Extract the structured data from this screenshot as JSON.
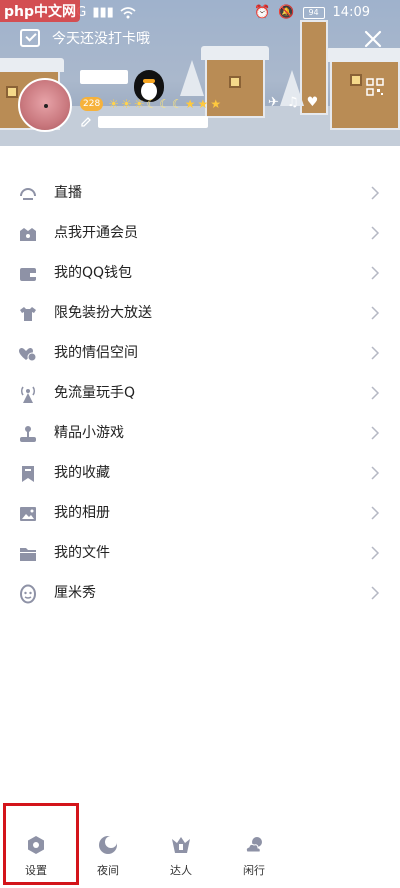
{
  "watermark": "php中文网",
  "status_bar": {
    "signal": "4G",
    "battery": "94",
    "time": "14:09"
  },
  "header": {
    "checkin_text": "今天还没打卡哦",
    "level_badge": "228",
    "icons": [
      "calendar-check-icon",
      "close-icon",
      "qr-code-icon",
      "edit-icon"
    ]
  },
  "menu": {
    "items": [
      {
        "label": "直播",
        "icon": "live-icon"
      },
      {
        "label": "点我开通会员",
        "icon": "vip-crown-icon"
      },
      {
        "label": "我的QQ钱包",
        "icon": "wallet-icon"
      },
      {
        "label": "限免装扮大放送",
        "icon": "shirt-icon"
      },
      {
        "label": "我的情侣空间",
        "icon": "hearts-icon"
      },
      {
        "label": "免流量玩手Q",
        "icon": "antenna-icon"
      },
      {
        "label": "精品小游戏",
        "icon": "joystick-icon"
      },
      {
        "label": "我的收藏",
        "icon": "bookmark-icon"
      },
      {
        "label": "我的相册",
        "icon": "photo-icon"
      },
      {
        "label": "我的文件",
        "icon": "folder-icon"
      },
      {
        "label": "厘米秀",
        "icon": "face-icon"
      }
    ]
  },
  "bottom_bar": {
    "tabs": [
      {
        "label": "设置",
        "icon": "settings-icon"
      },
      {
        "label": "夜间",
        "icon": "moon-icon"
      },
      {
        "label": "达人",
        "icon": "talent-icon"
      },
      {
        "label": "闲行",
        "icon": "weather-icon"
      }
    ]
  },
  "colors": {
    "icon_gray": "#8e92a6",
    "highlight_red": "#d3141a"
  }
}
